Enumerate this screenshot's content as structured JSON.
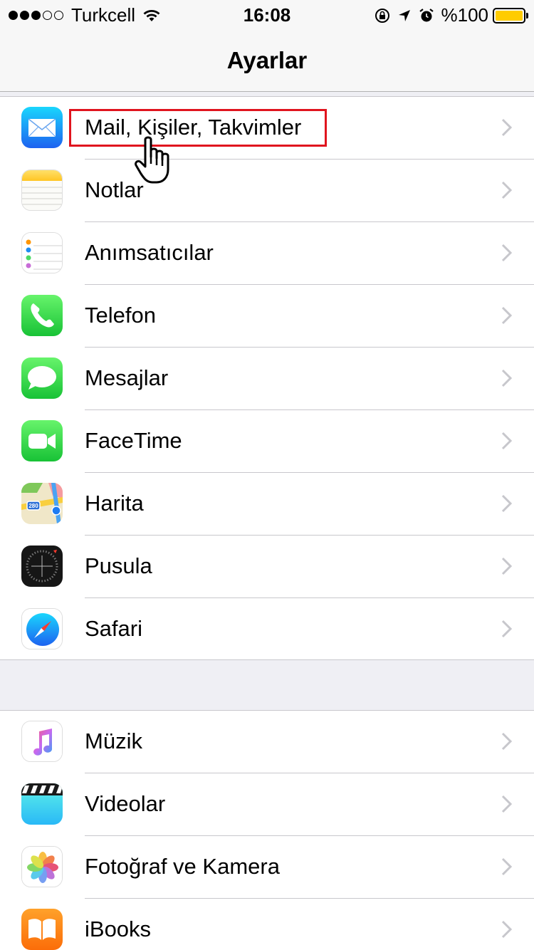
{
  "status_bar": {
    "signal_bars_filled": 3,
    "signal_bars_total": 5,
    "carrier": "Turkcell",
    "time": "16:08",
    "battery_text": "%100",
    "battery_level": 1.0
  },
  "nav": {
    "title": "Ayarlar"
  },
  "group1": [
    {
      "label": "Mail, Kişiler, Takvimler",
      "icon": "mail-icon"
    },
    {
      "label": "Notlar",
      "icon": "notes-icon"
    },
    {
      "label": "Anımsatıcılar",
      "icon": "reminders-icon"
    },
    {
      "label": "Telefon",
      "icon": "phone-icon"
    },
    {
      "label": "Mesajlar",
      "icon": "messages-icon"
    },
    {
      "label": "FaceTime",
      "icon": "facetime-icon"
    },
    {
      "label": "Harita",
      "icon": "maps-icon"
    },
    {
      "label": "Pusula",
      "icon": "compass-icon"
    },
    {
      "label": "Safari",
      "icon": "safari-icon"
    }
  ],
  "group2": [
    {
      "label": "Müzik",
      "icon": "music-icon"
    },
    {
      "label": "Videolar",
      "icon": "videos-icon"
    },
    {
      "label": "Fotoğraf ve Kamera",
      "icon": "photos-icon"
    },
    {
      "label": "iBooks",
      "icon": "ibooks-icon"
    }
  ],
  "annotation": {
    "highlight_color": "#e0141e",
    "pointer": "hand-pointer-icon"
  },
  "colors": {
    "background": "#efeff4",
    "battery": "#ffcc00",
    "separator": "#c8c7cc",
    "chevron": "#c7c7cc"
  }
}
